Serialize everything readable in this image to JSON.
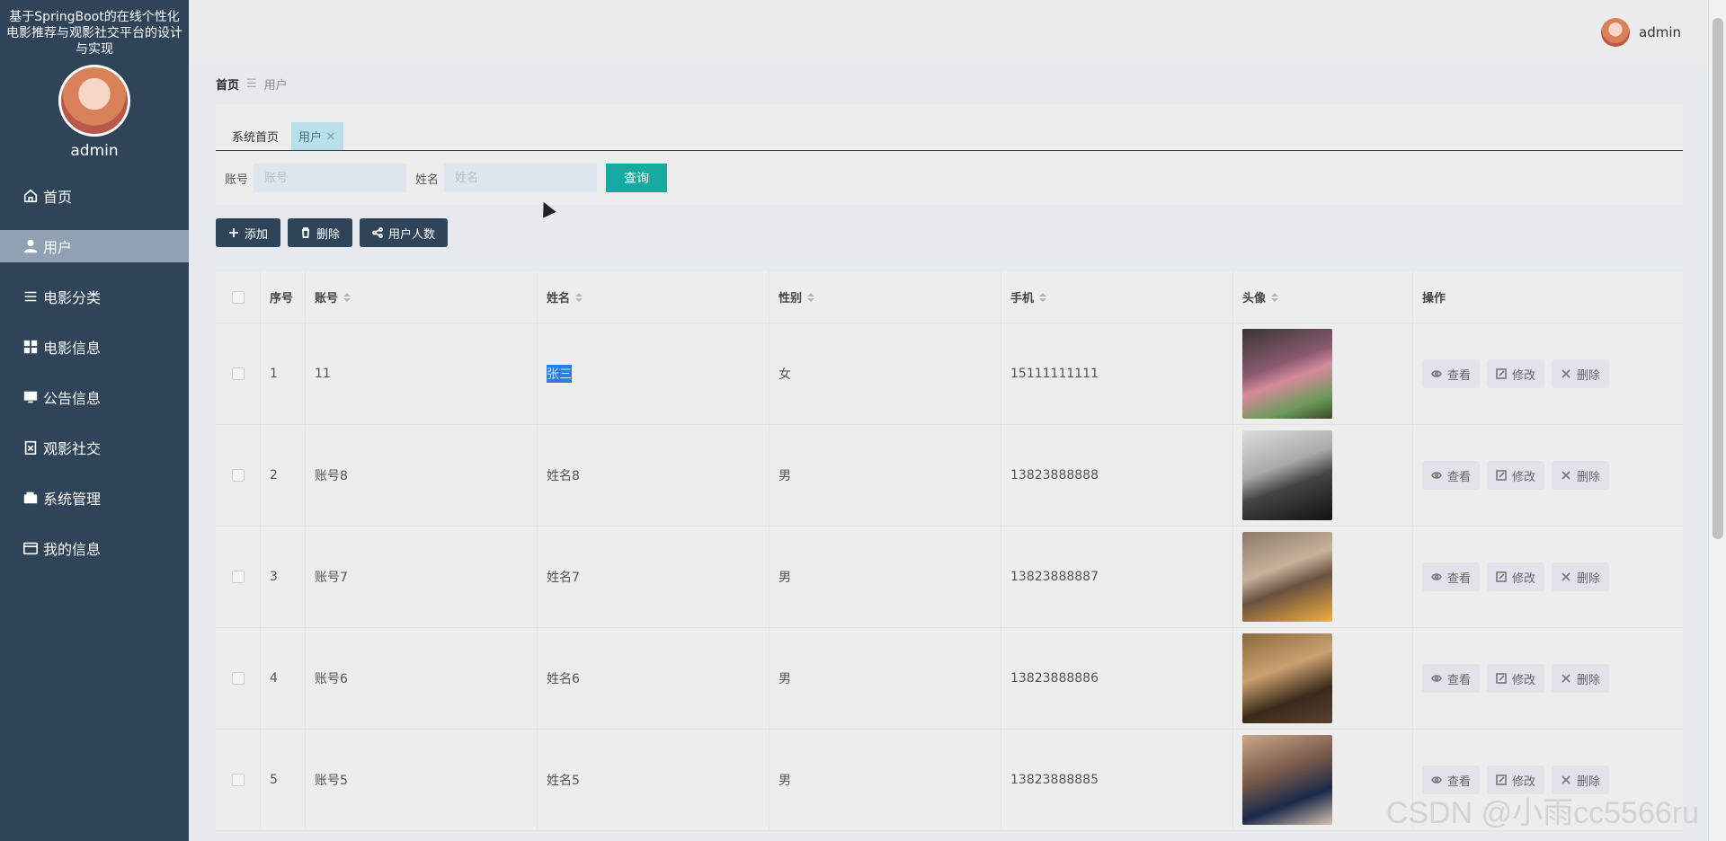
{
  "app": {
    "title": "基于SpringBoot的在线个性化电影推荐与观影社交平台的设计与实现"
  },
  "sidebar": {
    "username": "admin",
    "items": [
      {
        "label": "首页",
        "icon": "home-icon"
      },
      {
        "label": "用户",
        "icon": "user-icon",
        "active": true
      },
      {
        "label": "电影分类",
        "icon": "list-icon"
      },
      {
        "label": "电影信息",
        "icon": "grid-icon"
      },
      {
        "label": "公告信息",
        "icon": "monitor-icon"
      },
      {
        "label": "观影社交",
        "icon": "clipboard-icon"
      },
      {
        "label": "系统管理",
        "icon": "wallet-icon"
      },
      {
        "label": "我的信息",
        "icon": "card-icon"
      }
    ]
  },
  "header": {
    "username": "admin"
  },
  "breadcrumb": {
    "home": "首页",
    "separator": "☰",
    "current": "用户"
  },
  "tabs": [
    {
      "label": "系统首页"
    },
    {
      "label": "用户",
      "active": true
    }
  ],
  "search": {
    "account_label": "账号",
    "account_placeholder": "账号",
    "name_label": "姓名",
    "name_placeholder": "姓名",
    "query_button": "查询"
  },
  "actions": {
    "add": "添加",
    "delete": "删除",
    "user_count": "用户人数"
  },
  "table": {
    "headers": {
      "no": "序号",
      "account": "账号",
      "name": "姓名",
      "sex": "性别",
      "phone": "手机",
      "photo": "头像",
      "op": "操作"
    },
    "rows": [
      {
        "no": "1",
        "account": "11",
        "name": "张三",
        "sex": "女",
        "phone": "15111111111"
      },
      {
        "no": "2",
        "account": "账号8",
        "name": "姓名8",
        "sex": "男",
        "phone": "13823888888"
      },
      {
        "no": "3",
        "account": "账号7",
        "name": "姓名7",
        "sex": "男",
        "phone": "13823888887"
      },
      {
        "no": "4",
        "account": "账号6",
        "name": "姓名6",
        "sex": "男",
        "phone": "13823888886"
      },
      {
        "no": "5",
        "account": "账号5",
        "name": "姓名5",
        "sex": "男",
        "phone": "13823888885"
      }
    ],
    "row_actions": {
      "view": "查看",
      "edit": "修改",
      "delete": "删除"
    }
  },
  "watermark": "CSDN @小雨cc5566ru",
  "colors": {
    "sidebar": "#2f4458",
    "accent": "#17aaa0",
    "active_menu": "#8fa1b3",
    "tab_active": "#b7e0ea"
  }
}
